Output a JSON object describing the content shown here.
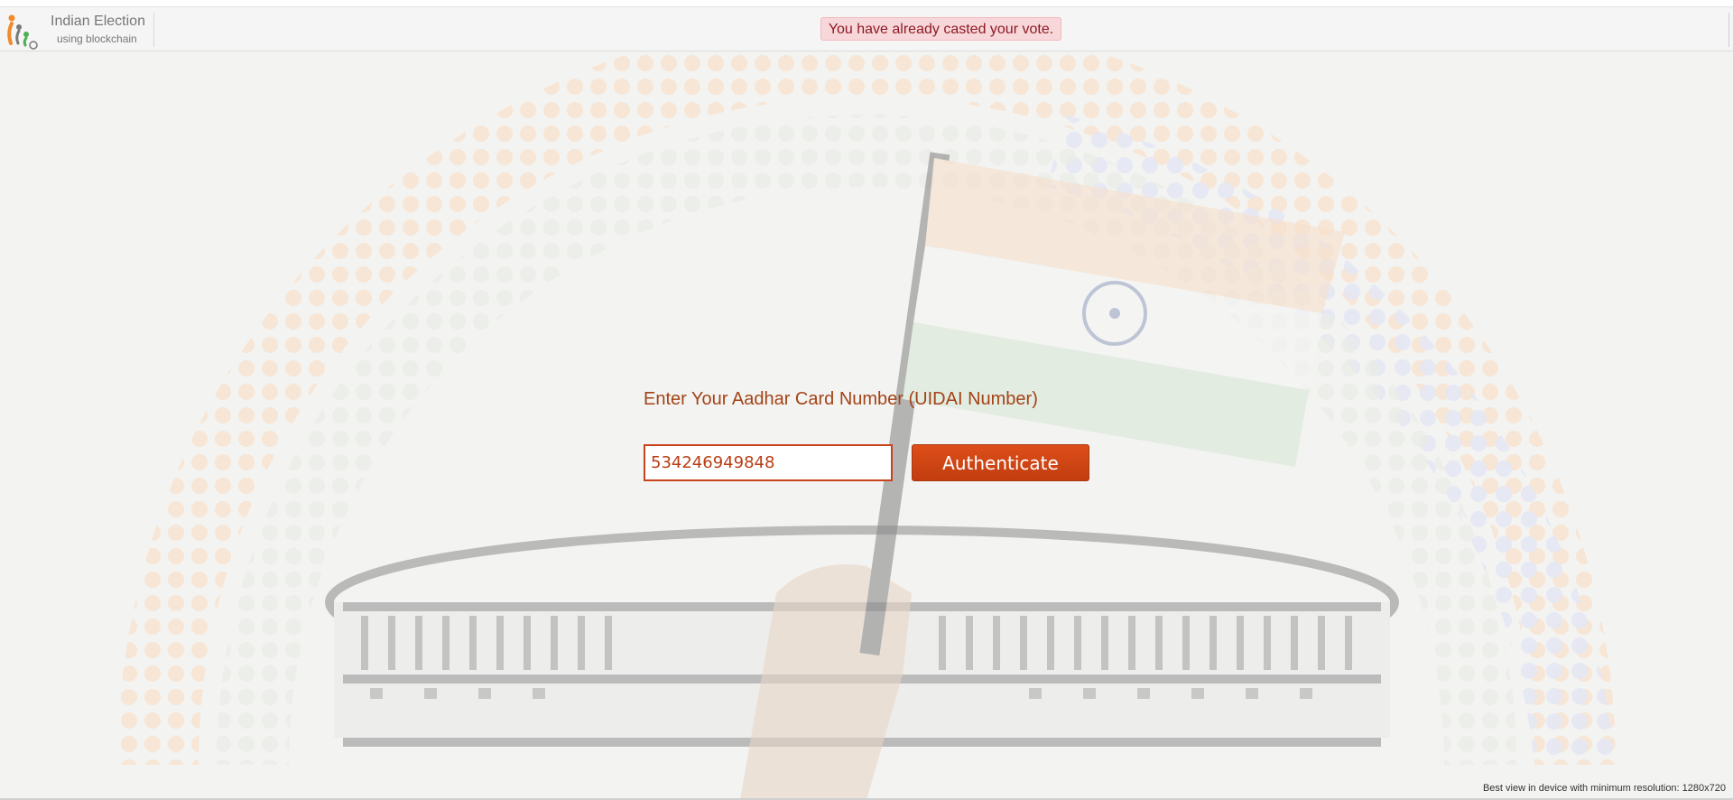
{
  "header": {
    "brand_title": "Indian Election",
    "brand_subtitle": "using blockchain",
    "logo_icon": "voter-logo-icon"
  },
  "alert": {
    "message": "You have already casted your vote."
  },
  "form": {
    "prompt": "Enter Your Aadhar Card Number (UIDAI Number)",
    "aadhar_value": "534246949848",
    "button_label": "Authenticate"
  },
  "footer": {
    "note": "Best view in device with minimum resolution: 1280x720"
  },
  "colors": {
    "accent": "#c8421c",
    "prompt_text": "#a34317",
    "alert_bg": "#f8d7da",
    "alert_text": "#8c1a24"
  }
}
